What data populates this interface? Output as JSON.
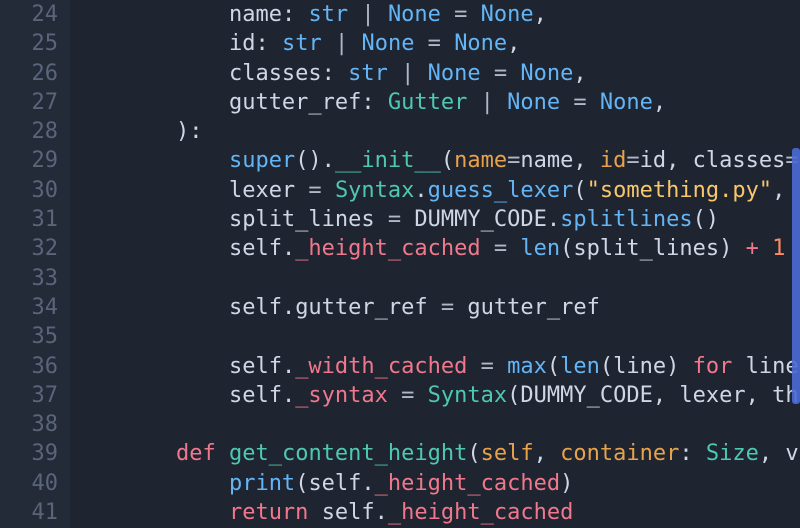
{
  "lines": [
    {
      "num": "24",
      "indent": 3,
      "tokens": [
        {
          "t": "name",
          "cls": "tok-d"
        },
        {
          "t": ": ",
          "cls": "tok-d"
        },
        {
          "t": "str",
          "cls": "tok-b"
        },
        {
          "t": " | ",
          "cls": "tok-o"
        },
        {
          "t": "None",
          "cls": "tok-b"
        },
        {
          "t": " = ",
          "cls": "tok-o"
        },
        {
          "t": "None",
          "cls": "tok-b"
        },
        {
          "t": ",",
          "cls": "tok-d"
        }
      ]
    },
    {
      "num": "25",
      "indent": 3,
      "tokens": [
        {
          "t": "id",
          "cls": "tok-d"
        },
        {
          "t": ": ",
          "cls": "tok-d"
        },
        {
          "t": "str",
          "cls": "tok-b"
        },
        {
          "t": " | ",
          "cls": "tok-o"
        },
        {
          "t": "None",
          "cls": "tok-b"
        },
        {
          "t": " = ",
          "cls": "tok-o"
        },
        {
          "t": "None",
          "cls": "tok-b"
        },
        {
          "t": ",",
          "cls": "tok-d"
        }
      ]
    },
    {
      "num": "26",
      "indent": 3,
      "tokens": [
        {
          "t": "classes",
          "cls": "tok-d"
        },
        {
          "t": ": ",
          "cls": "tok-d"
        },
        {
          "t": "str",
          "cls": "tok-b"
        },
        {
          "t": " | ",
          "cls": "tok-o"
        },
        {
          "t": "None",
          "cls": "tok-b"
        },
        {
          "t": " = ",
          "cls": "tok-o"
        },
        {
          "t": "None",
          "cls": "tok-b"
        },
        {
          "t": ",",
          "cls": "tok-d"
        }
      ]
    },
    {
      "num": "27",
      "indent": 3,
      "tokens": [
        {
          "t": "gutter_ref",
          "cls": "tok-d"
        },
        {
          "t": ": ",
          "cls": "tok-d"
        },
        {
          "t": "Gutter",
          "cls": "tok-t"
        },
        {
          "t": " | ",
          "cls": "tok-o"
        },
        {
          "t": "None",
          "cls": "tok-b"
        },
        {
          "t": " = ",
          "cls": "tok-o"
        },
        {
          "t": "None",
          "cls": "tok-b"
        },
        {
          "t": ",",
          "cls": "tok-d"
        }
      ]
    },
    {
      "num": "28",
      "indent": 2,
      "tokens": [
        {
          "t": "):",
          "cls": "tok-d"
        }
      ]
    },
    {
      "num": "29",
      "indent": 3,
      "tokens": [
        {
          "t": "super",
          "cls": "tok-b"
        },
        {
          "t": "().",
          "cls": "tok-d"
        },
        {
          "t": "__init__",
          "cls": "tok-mag"
        },
        {
          "t": "(",
          "cls": "tok-d"
        },
        {
          "t": "name",
          "cls": "tok-pa"
        },
        {
          "t": "=",
          "cls": "tok-o"
        },
        {
          "t": "name",
          "cls": "tok-d"
        },
        {
          "t": ", ",
          "cls": "tok-d"
        },
        {
          "t": "id",
          "cls": "tok-pa"
        },
        {
          "t": "=",
          "cls": "tok-o"
        },
        {
          "t": "id",
          "cls": "tok-d"
        },
        {
          "t": ", ",
          "cls": "tok-d"
        },
        {
          "t": "classes",
          "cls": "tok-d"
        },
        {
          "t": "=",
          "cls": "tok-o"
        }
      ]
    },
    {
      "num": "30",
      "indent": 3,
      "tokens": [
        {
          "t": "lexer",
          "cls": "tok-d"
        },
        {
          "t": " = ",
          "cls": "tok-o"
        },
        {
          "t": "Syntax",
          "cls": "tok-t"
        },
        {
          "t": ".",
          "cls": "tok-d"
        },
        {
          "t": "guess_lexer",
          "cls": "tok-fn"
        },
        {
          "t": "(",
          "cls": "tok-d"
        },
        {
          "t": "\"something.py\"",
          "cls": "tok-s"
        },
        {
          "t": ",",
          "cls": "tok-d"
        }
      ]
    },
    {
      "num": "31",
      "indent": 3,
      "tokens": [
        {
          "t": "split_lines",
          "cls": "tok-d"
        },
        {
          "t": " = ",
          "cls": "tok-o"
        },
        {
          "t": "DUMMY_CODE",
          "cls": "tok-d"
        },
        {
          "t": ".",
          "cls": "tok-d"
        },
        {
          "t": "splitlines",
          "cls": "tok-fn"
        },
        {
          "t": "()",
          "cls": "tok-d"
        }
      ]
    },
    {
      "num": "32",
      "indent": 3,
      "tokens": [
        {
          "t": "self",
          "cls": "tok-d"
        },
        {
          "t": ".",
          "cls": "tok-d"
        },
        {
          "t": "_height_cached",
          "cls": "tok-priv"
        },
        {
          "t": " = ",
          "cls": "tok-o"
        },
        {
          "t": "len",
          "cls": "tok-b"
        },
        {
          "t": "(",
          "cls": "tok-d"
        },
        {
          "t": "split_lines",
          "cls": "tok-d"
        },
        {
          "t": ") ",
          "cls": "tok-d"
        },
        {
          "t": "+",
          "cls": "tok-k"
        },
        {
          "t": " ",
          "cls": "tok-d"
        },
        {
          "t": "1",
          "cls": "tok-num"
        }
      ]
    },
    {
      "num": "33",
      "indent": 0,
      "tokens": []
    },
    {
      "num": "34",
      "indent": 3,
      "tokens": [
        {
          "t": "self",
          "cls": "tok-d"
        },
        {
          "t": ".",
          "cls": "tok-d"
        },
        {
          "t": "gutter_ref",
          "cls": "tok-d"
        },
        {
          "t": " = ",
          "cls": "tok-o"
        },
        {
          "t": "gutter_ref",
          "cls": "tok-d"
        }
      ]
    },
    {
      "num": "35",
      "indent": 0,
      "tokens": []
    },
    {
      "num": "36",
      "indent": 3,
      "tokens": [
        {
          "t": "self",
          "cls": "tok-d"
        },
        {
          "t": ".",
          "cls": "tok-d"
        },
        {
          "t": "_width_cached",
          "cls": "tok-priv"
        },
        {
          "t": " = ",
          "cls": "tok-o"
        },
        {
          "t": "max",
          "cls": "tok-b"
        },
        {
          "t": "(",
          "cls": "tok-d"
        },
        {
          "t": "len",
          "cls": "tok-b"
        },
        {
          "t": "(",
          "cls": "tok-d"
        },
        {
          "t": "line",
          "cls": "tok-d"
        },
        {
          "t": ") ",
          "cls": "tok-d"
        },
        {
          "t": "for",
          "cls": "tok-k"
        },
        {
          "t": " line",
          "cls": "tok-d"
        }
      ]
    },
    {
      "num": "37",
      "indent": 3,
      "tokens": [
        {
          "t": "self",
          "cls": "tok-d"
        },
        {
          "t": ".",
          "cls": "tok-d"
        },
        {
          "t": "_syntax",
          "cls": "tok-priv"
        },
        {
          "t": " = ",
          "cls": "tok-o"
        },
        {
          "t": "Syntax",
          "cls": "tok-t"
        },
        {
          "t": "(",
          "cls": "tok-d"
        },
        {
          "t": "DUMMY_CODE",
          "cls": "tok-d"
        },
        {
          "t": ", ",
          "cls": "tok-d"
        },
        {
          "t": "lexer",
          "cls": "tok-d"
        },
        {
          "t": ", ",
          "cls": "tok-d"
        },
        {
          "t": "th",
          "cls": "tok-d"
        }
      ]
    },
    {
      "num": "38",
      "indent": 0,
      "tokens": []
    },
    {
      "num": "39",
      "indent": 2,
      "tokens": [
        {
          "t": "def",
          "cls": "tok-k"
        },
        {
          "t": " ",
          "cls": "tok-d"
        },
        {
          "t": "get_content_height",
          "cls": "tok-mag"
        },
        {
          "t": "(",
          "cls": "tok-d"
        },
        {
          "t": "self",
          "cls": "tok-pa"
        },
        {
          "t": ", ",
          "cls": "tok-d"
        },
        {
          "t": "container",
          "cls": "tok-pa"
        },
        {
          "t": ": ",
          "cls": "tok-d"
        },
        {
          "t": "Size",
          "cls": "tok-t"
        },
        {
          "t": ", ",
          "cls": "tok-d"
        },
        {
          "t": "v",
          "cls": "tok-d"
        }
      ]
    },
    {
      "num": "40",
      "indent": 3,
      "tokens": [
        {
          "t": "print",
          "cls": "tok-b"
        },
        {
          "t": "(",
          "cls": "tok-d"
        },
        {
          "t": "self",
          "cls": "tok-d"
        },
        {
          "t": ".",
          "cls": "tok-d"
        },
        {
          "t": "_height_cached",
          "cls": "tok-priv"
        },
        {
          "t": ")",
          "cls": "tok-d"
        }
      ]
    },
    {
      "num": "41",
      "indent": 3,
      "tokens": [
        {
          "t": "return",
          "cls": "tok-k"
        },
        {
          "t": " ",
          "cls": "tok-d"
        },
        {
          "t": "self",
          "cls": "tok-d"
        },
        {
          "t": ".",
          "cls": "tok-d"
        },
        {
          "t": "_height_cached",
          "cls": "tok-priv"
        }
      ]
    }
  ]
}
